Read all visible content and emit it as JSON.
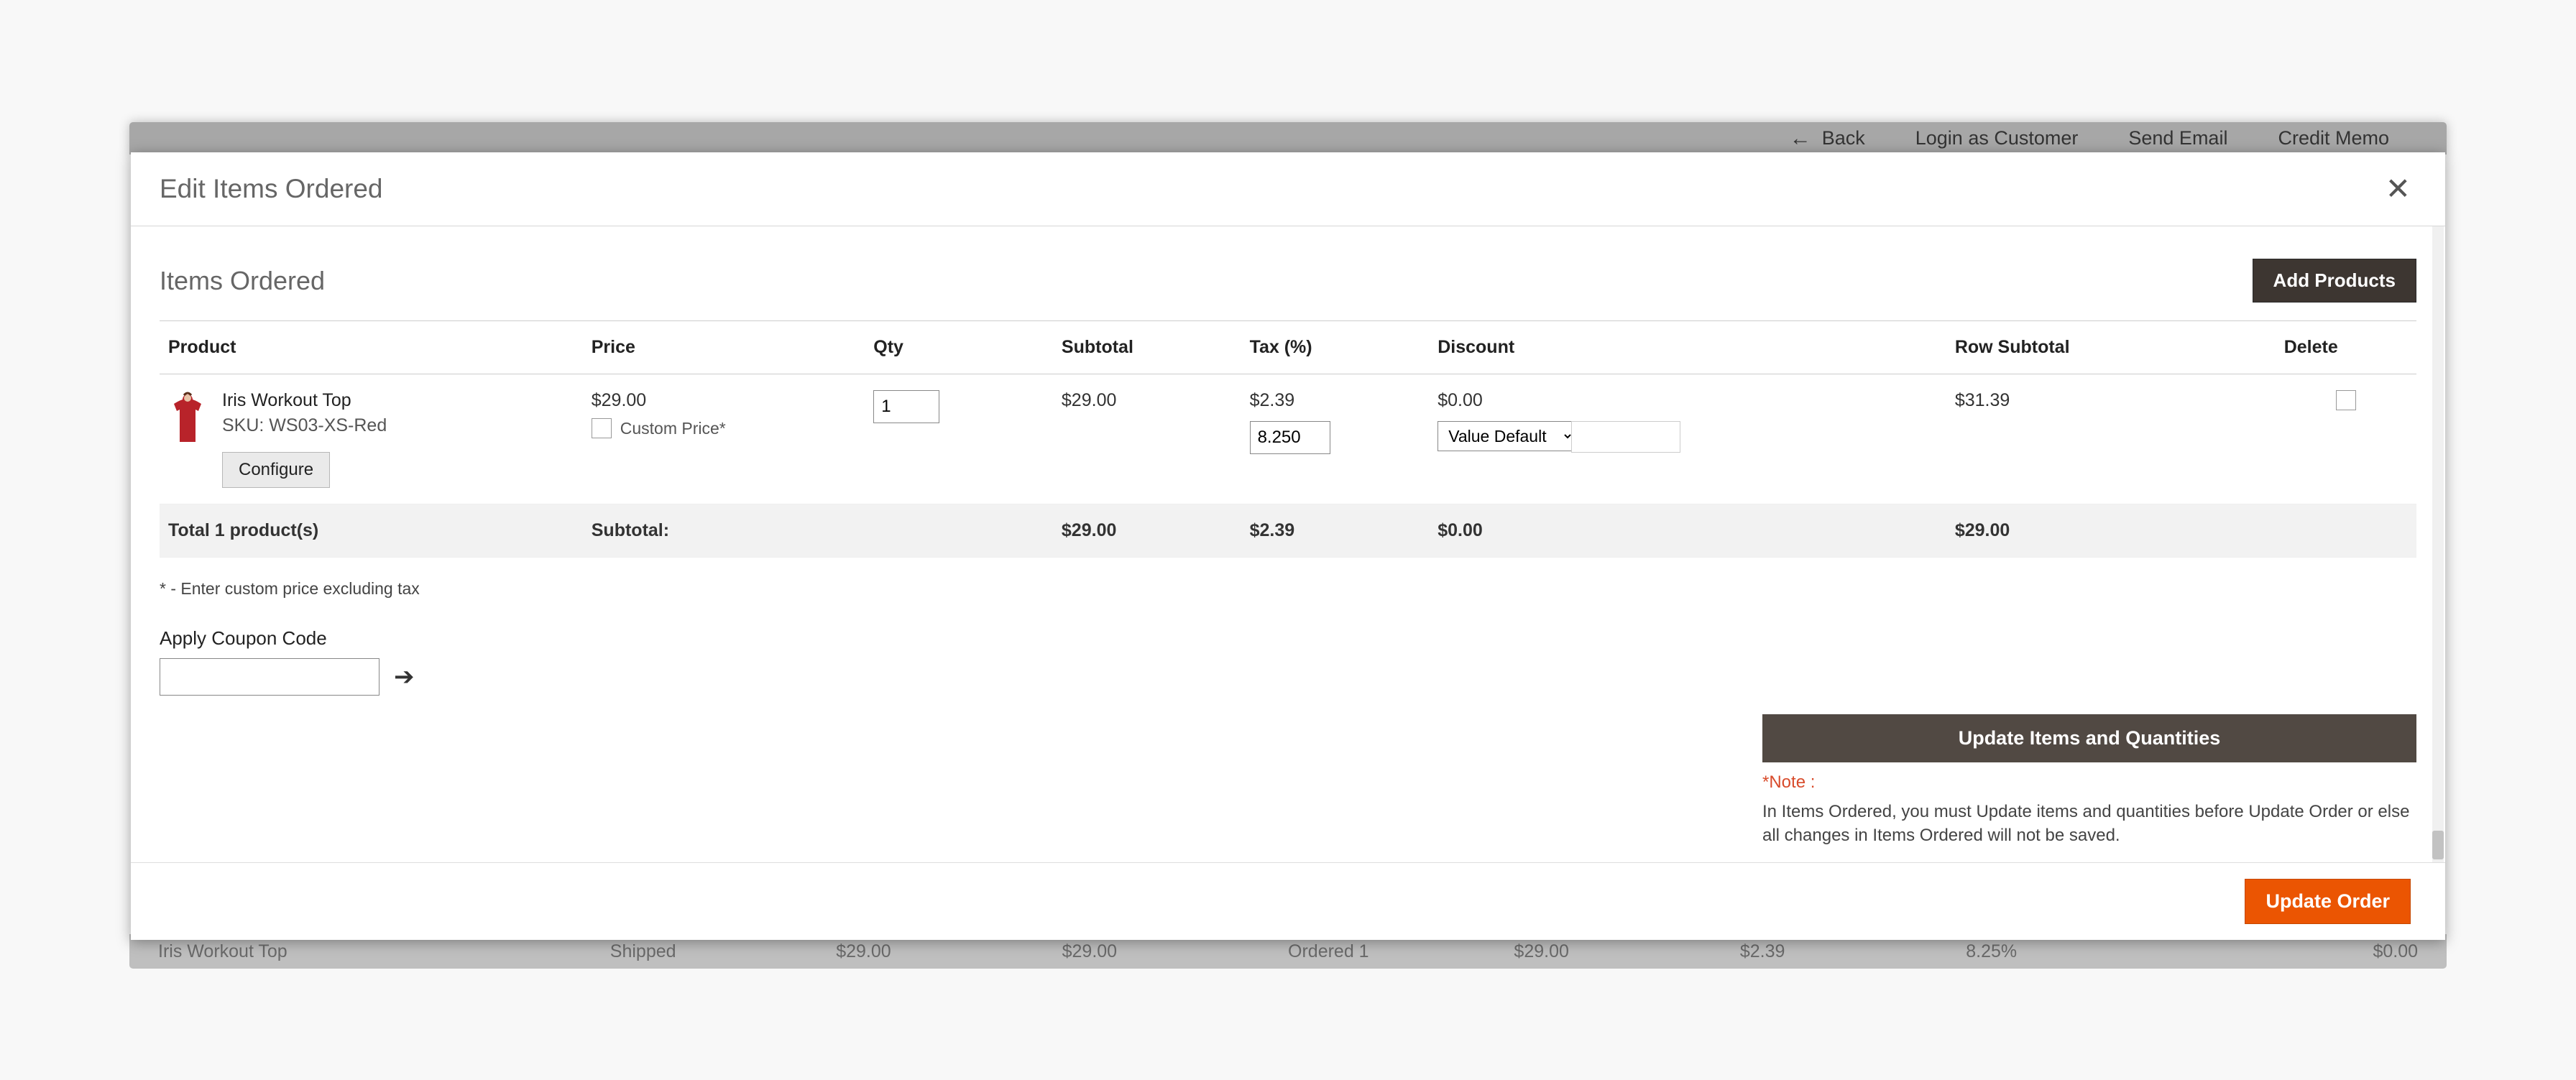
{
  "behind": {
    "back": "Back",
    "login_as_customer": "Login as Customer",
    "send_email": "Send Email",
    "credit_memo": "Credit Memo",
    "row": {
      "c1": "Iris Workout Top",
      "c2": "Shipped",
      "c3": "$29.00",
      "c4": "$29.00",
      "c5": "Ordered   1",
      "c6": "$29.00",
      "c7": "$2.39",
      "c8": "8.25%",
      "c9": "$0.00"
    }
  },
  "modal": {
    "title": "Edit Items Ordered",
    "section_title": "Items Ordered",
    "add_products": "Add Products",
    "columns": {
      "product": "Product",
      "price": "Price",
      "qty": "Qty",
      "subtotal": "Subtotal",
      "tax": "Tax (%)",
      "discount": "Discount",
      "row_subtotal": "Row Subtotal",
      "delete": "Delete"
    },
    "item": {
      "name": "Iris Workout Top",
      "sku": "SKU: WS03-XS-Red",
      "configure": "Configure",
      "price": "$29.00",
      "custom_price_label": "Custom Price*",
      "qty": "1",
      "subtotal": "$29.00",
      "tax_amount": "$2.39",
      "tax_pct": "8.250",
      "discount_fixed": "$0.00",
      "discount_option": "Value Default",
      "row_subtotal": "$31.39"
    },
    "totals": {
      "label": "Total 1 product(s)",
      "subtotal_label": "Subtotal:",
      "subtotal": "$29.00",
      "tax": "$2.39",
      "discount": "$0.00",
      "row_subtotal": "$29.00"
    },
    "custom_price_note": "* - Enter custom price excluding tax",
    "coupon": {
      "label": "Apply Coupon Code"
    },
    "update_items_btn": "Update Items and Quantities",
    "note_star": "*Note :",
    "note_text": "In Items Ordered, you must Update items and quantities before Update Order or else all changes in Items Ordered will not be saved.",
    "update_order": "Update Order"
  }
}
